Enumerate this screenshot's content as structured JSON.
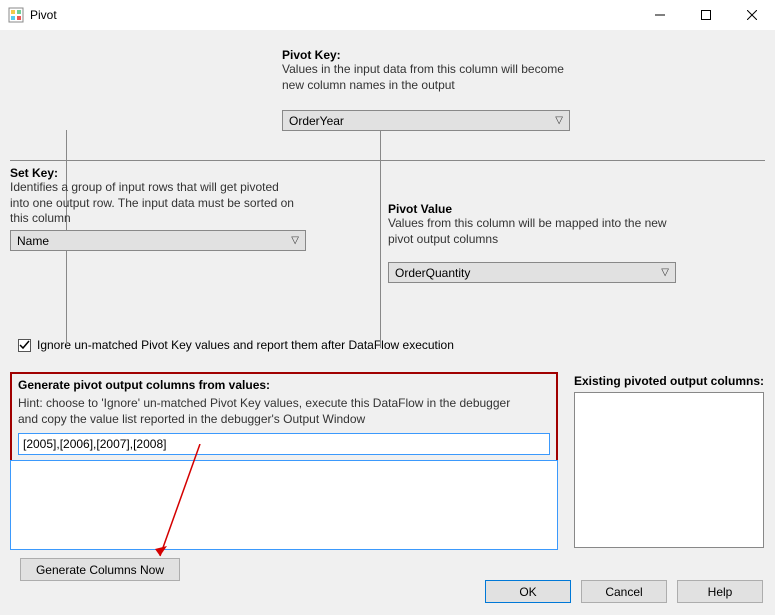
{
  "window": {
    "title": "Pivot"
  },
  "pivotKey": {
    "heading": "Pivot Key:",
    "desc1": "Values in the input data from this column will become",
    "desc2": "new column names in the output",
    "value": "OrderYear"
  },
  "setKey": {
    "heading": "Set Key:",
    "desc1": "Identifies a group of input rows that will get pivoted",
    "desc2": "into one output row. The input data must be sorted on",
    "desc3": "this column",
    "value": "Name"
  },
  "pivotValue": {
    "heading": "Pivot Value",
    "desc1": "Values from this column will be mapped into the new",
    "desc2": "pivot output columns",
    "value": "OrderQuantity"
  },
  "checkbox": {
    "label": "Ignore un-matched Pivot Key values and report them after DataFlow execution"
  },
  "generate": {
    "heading": "Generate pivot output columns from values:",
    "hint1": "Hint: choose to 'Ignore' un-matched Pivot Key values, execute this DataFlow in the debugger",
    "hint2": "and copy the value list reported in the debugger's Output Window",
    "inputValue": "[2005],[2006],[2007],[2008]",
    "button": "Generate Columns Now"
  },
  "existing": {
    "heading": "Existing pivoted output columns:"
  },
  "buttons": {
    "ok": "OK",
    "cancel": "Cancel",
    "help": "Help"
  }
}
